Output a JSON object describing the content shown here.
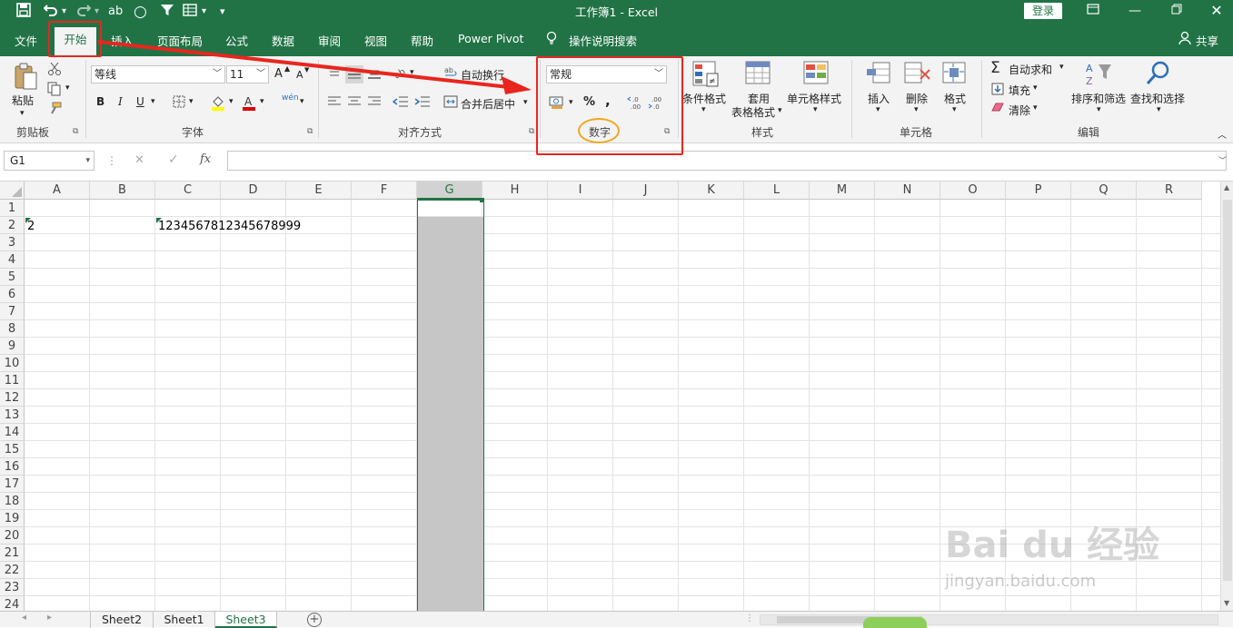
{
  "titlebar": {
    "title": "工作簿1  -  Excel",
    "login_label": "登录",
    "qa_save": "💾",
    "qa_undo": "↶",
    "qa_redo": "↷",
    "qa_spell": "ab",
    "qa_circle": "○",
    "qa_filter": "▼",
    "qa_more": "▾"
  },
  "tabs": {
    "file": "文件",
    "home": "开始",
    "insert": "插入",
    "layout": "页面布局",
    "formulas": "公式",
    "data": "数据",
    "review": "审阅",
    "view": "视图",
    "help": "帮助",
    "powerpivot": "Power Pivot",
    "tellme": "操作说明搜索",
    "share": "共享"
  },
  "ribbon": {
    "clipboard": {
      "paste": "粘贴",
      "group": "剪贴板"
    },
    "font": {
      "name": "等线",
      "size": "11",
      "bold": "B",
      "italic": "I",
      "underline": "U",
      "grow": "A",
      "shrink": "A",
      "wen": "wén",
      "group": "字体"
    },
    "align": {
      "wrap": "自动换行",
      "merge": "合并后居中",
      "group": "对齐方式"
    },
    "number": {
      "format": "常规",
      "percent": "%",
      "comma": ",",
      "group": "数字"
    },
    "styles": {
      "cond": "条件格式",
      "table1": "套用",
      "table2": "表格格式",
      "cell": "单元格样式",
      "group": "样式"
    },
    "cells": {
      "insert": "插入",
      "delete": "删除",
      "format": "格式",
      "group": "单元格"
    },
    "editing": {
      "autosum": "自动求和",
      "fill": "填充",
      "clear": "清除",
      "sort": "排序和筛选",
      "find": "查找和选择",
      "group": "编辑"
    }
  },
  "formulabar": {
    "namebox": "G1",
    "fx": "fx",
    "cancel": "✕",
    "enter": "✓"
  },
  "grid": {
    "columns": [
      "A",
      "B",
      "C",
      "D",
      "E",
      "F",
      "G",
      "H",
      "I",
      "J",
      "K",
      "L",
      "M",
      "N",
      "O",
      "P",
      "Q",
      "R"
    ],
    "rows": [
      "1",
      "2",
      "3",
      "4",
      "5",
      "6",
      "7",
      "8",
      "9",
      "10",
      "11",
      "12",
      "13",
      "14",
      "15",
      "16",
      "17",
      "18",
      "19",
      "20",
      "21",
      "22",
      "23",
      "24"
    ],
    "cells": {
      "A2": "2",
      "C2": "1234567812345678999"
    },
    "selected_column": "G"
  },
  "sheets": {
    "tabs": [
      "Sheet2",
      "Sheet1",
      "Sheet3"
    ],
    "active": "Sheet3",
    "add": "+"
  },
  "watermark": {
    "brand": "Bai du 经验",
    "url": "jingyan.baidu.com"
  },
  "colors": {
    "accent": "#217346",
    "annotation_red": "#e8261e",
    "annotation_orange": "#f0a81c"
  }
}
